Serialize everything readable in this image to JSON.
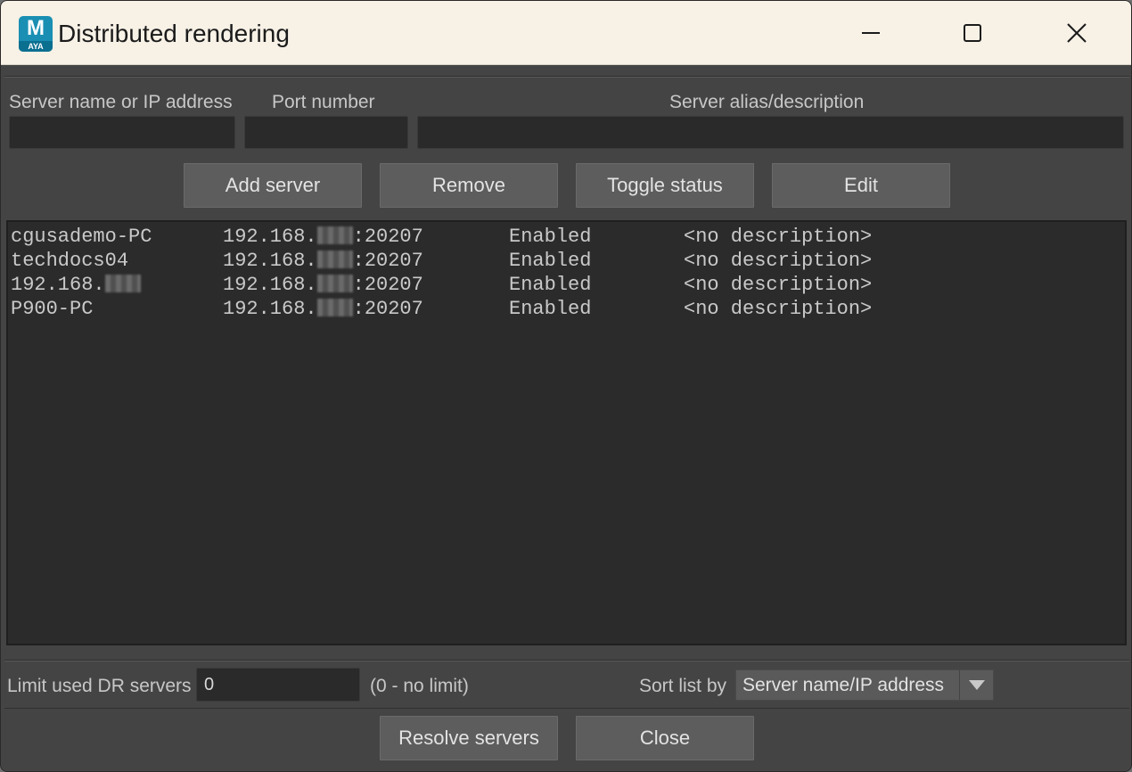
{
  "window": {
    "title": "Distributed rendering",
    "app_icon_letter": "M",
    "app_icon_sub": "AYA"
  },
  "form": {
    "server_label": "Server name or IP address",
    "port_label": "Port number",
    "alias_label": "Server alias/description",
    "server_value": "",
    "port_value": "",
    "alias_value": ""
  },
  "buttons": {
    "add": "Add server",
    "remove": "Remove",
    "toggle": "Toggle status",
    "edit": "Edit",
    "resolve": "Resolve servers",
    "close": "Close"
  },
  "servers": [
    {
      "name": "cgusademo-PC",
      "name_redacted": false,
      "ip_prefix": "192.168.",
      "port": ":20207",
      "status": "Enabled",
      "description": "<no description>"
    },
    {
      "name": "techdocs04",
      "name_redacted": false,
      "ip_prefix": "192.168.",
      "port": ":20207",
      "status": "Enabled",
      "description": "<no description>"
    },
    {
      "name": "192.168.",
      "name_redacted": true,
      "ip_prefix": "192.168.",
      "port": ":20207",
      "status": "Enabled",
      "description": "<no description>"
    },
    {
      "name": "P900-PC",
      "name_redacted": false,
      "ip_prefix": "192.168.",
      "port": ":20207",
      "status": "Enabled",
      "description": "<no description>"
    }
  ],
  "footer": {
    "limit_label": "Limit used DR servers",
    "limit_value": "0",
    "limit_hint": "(0 - no limit)",
    "sort_label": "Sort list by",
    "sort_value": "Server name/IP address"
  }
}
